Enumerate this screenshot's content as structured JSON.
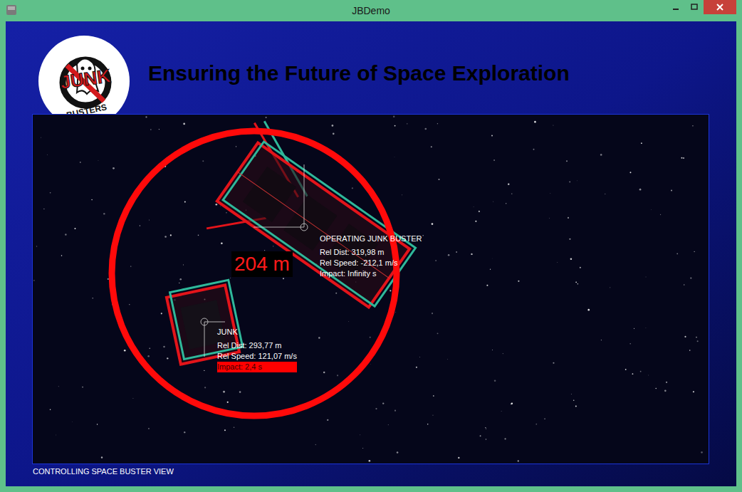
{
  "window": {
    "title": "JBDemo"
  },
  "logo": {
    "top": "JUNK",
    "bottom": "BUSTERS"
  },
  "heading": "Ensuring the Future of Space Exploration",
  "view": {
    "caption": "CONTROLLING SPACE BUSTER VIEW",
    "distance": "204 m",
    "objects": [
      {
        "name": "OPERATING JUNK BUSTER",
        "dist": "Rel Dist: 319,98 m",
        "speed": "Rel Speed: -212,1 m/s",
        "impact": "Impact: Infinity s",
        "alert": false
      },
      {
        "name": "JUNK",
        "dist": "Rel Dist: 293,77 m",
        "speed": "Rel Speed: 121,07 m/s",
        "impact": "Impact: 2,4 s",
        "alert": true
      }
    ]
  }
}
